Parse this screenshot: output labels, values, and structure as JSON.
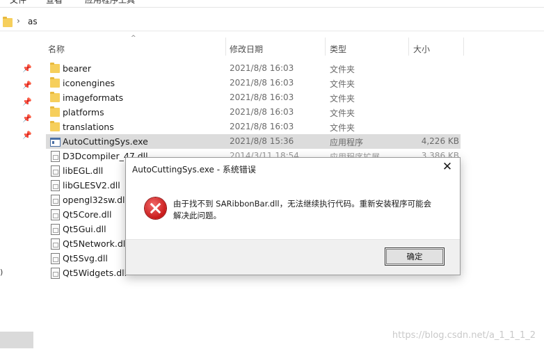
{
  "ribbon": {
    "items": [
      "文件",
      "查看",
      "应用程序工具"
    ]
  },
  "address": {
    "path": "as"
  },
  "nav": {
    "fragment": ")"
  },
  "columns": {
    "name": "名称",
    "date": "修改日期",
    "type": "类型",
    "size": "大小"
  },
  "files": [
    {
      "name": "bearer",
      "date": "2021/8/8 16:03",
      "type": "文件夹",
      "size": "",
      "kind": "folder"
    },
    {
      "name": "iconengines",
      "date": "2021/8/8 16:03",
      "type": "文件夹",
      "size": "",
      "kind": "folder"
    },
    {
      "name": "imageformats",
      "date": "2021/8/8 16:03",
      "type": "文件夹",
      "size": "",
      "kind": "folder"
    },
    {
      "name": "platforms",
      "date": "2021/8/8 16:03",
      "type": "文件夹",
      "size": "",
      "kind": "folder"
    },
    {
      "name": "translations",
      "date": "2021/8/8 16:03",
      "type": "文件夹",
      "size": "",
      "kind": "folder"
    },
    {
      "name": "AutoCuttingSys.exe",
      "date": "2021/8/8 15:36",
      "type": "应用程序",
      "size": "4,226 KB",
      "kind": "exe"
    },
    {
      "name": "D3Dcompiler_47.dll",
      "date": "2014/3/11 18:54",
      "type": "应用程序扩展",
      "size": "3,386 KB",
      "kind": "dll"
    },
    {
      "name": "libEGL.dll",
      "date": "",
      "type": "",
      "size": "",
      "kind": "dll"
    },
    {
      "name": "libGLESV2.dll",
      "date": "",
      "type": "",
      "size": "",
      "kind": "dll"
    },
    {
      "name": "opengl32sw.dll",
      "date": "",
      "type": "",
      "size": "",
      "kind": "dll"
    },
    {
      "name": "Qt5Core.dll",
      "date": "",
      "type": "",
      "size": "",
      "kind": "dll"
    },
    {
      "name": "Qt5Gui.dll",
      "date": "",
      "type": "",
      "size": "",
      "kind": "dll"
    },
    {
      "name": "Qt5Network.dll",
      "date": "",
      "type": "",
      "size": "",
      "kind": "dll"
    },
    {
      "name": "Qt5Svg.dll",
      "date": "",
      "type": "",
      "size": "",
      "kind": "dll"
    },
    {
      "name": "Qt5Widgets.dll",
      "date": "",
      "type": "",
      "size": "",
      "kind": "dll"
    }
  ],
  "dialog": {
    "title": "AutoCuttingSys.exe - 系统错误",
    "close_label": "✕",
    "message": "由于找不到 SARibbonBar.dll，无法继续执行代码。重新安装程序可能会解决此问题。",
    "ok_label": "确定"
  },
  "watermark": "https://blog.csdn.net/a_1_1_1_2"
}
